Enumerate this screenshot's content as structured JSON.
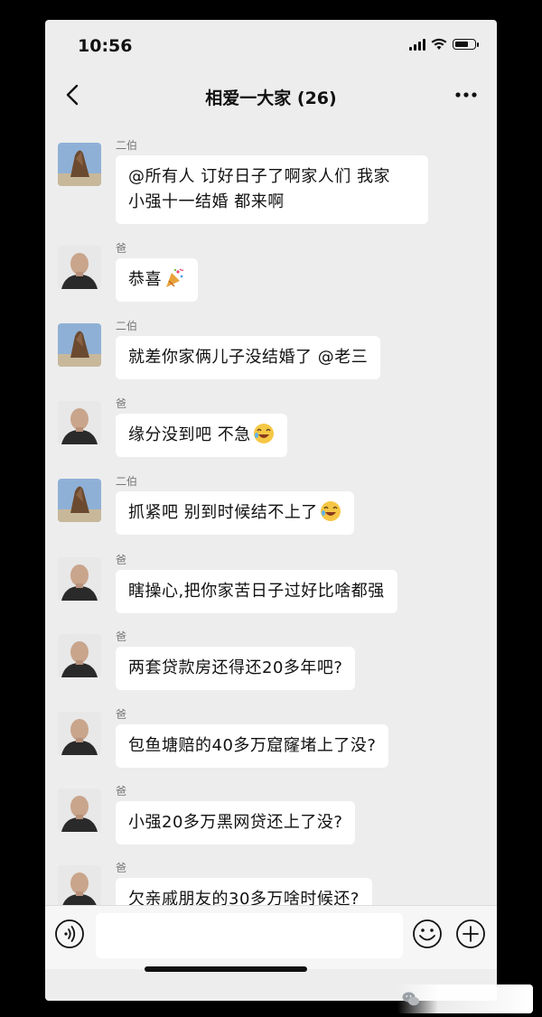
{
  "status_bar": {
    "time": "10:56"
  },
  "header": {
    "title": "相爱一大家 (26)"
  },
  "messages": [
    {
      "sender": "二伯",
      "avatar": "rock-avatar",
      "text": "@所有人 订好日子了啊家人们 我家",
      "text2": "小强十一结婚  都来啊"
    },
    {
      "sender": "爸",
      "avatar": "man-avatar",
      "text": "恭喜",
      "emoji": "party-popper"
    },
    {
      "sender": "二伯",
      "avatar": "rock-avatar",
      "text": "就差你家俩儿子没结婚了 @老三"
    },
    {
      "sender": "爸",
      "avatar": "man-avatar",
      "text": "缘分没到吧 不急",
      "emoji": "laughing-face"
    },
    {
      "sender": "二伯",
      "avatar": "rock-avatar",
      "text": "抓紧吧 别到时候结不上了",
      "emoji": "laughing-face"
    },
    {
      "sender": "爸",
      "avatar": "man-avatar",
      "text": "瞎操心,把你家苦日子过好比啥都强"
    },
    {
      "sender": "爸",
      "avatar": "man-avatar",
      "text": "两套贷款房还得还20多年吧?"
    },
    {
      "sender": "爸",
      "avatar": "man-avatar",
      "text": "包鱼塘赔的40多万窟窿堵上了没?"
    },
    {
      "sender": "爸",
      "avatar": "man-avatar",
      "text": "小强20多万黑网贷还上了没?"
    },
    {
      "sender": "爸",
      "avatar": "man-avatar",
      "text": "欠亲戚朋友的30多万啥时候还?"
    }
  ],
  "input_bar": {
    "value": "",
    "placeholder": ""
  },
  "colors": {
    "background": "#ededed",
    "bubble": "#ffffff",
    "sender_text": "#777777"
  }
}
